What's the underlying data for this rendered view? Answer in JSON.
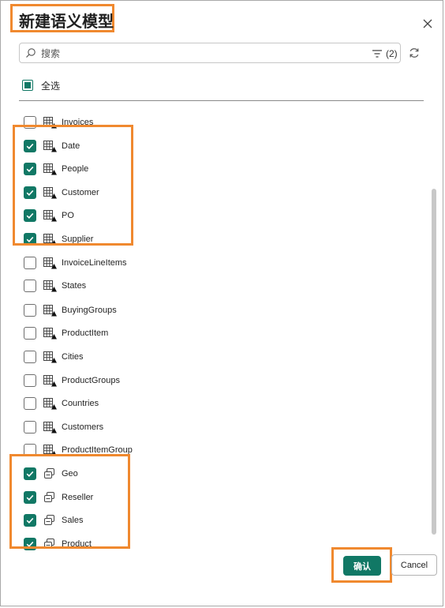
{
  "dialog": {
    "title": "新建语义模型",
    "close_icon": "close-icon"
  },
  "search": {
    "placeholder": "搜索",
    "filter_count": "(2)",
    "search_icon": "search-icon",
    "filter_icon": "filter-icon",
    "refresh_icon": "refresh-icon"
  },
  "select_all": {
    "label": "全选",
    "state": "indeterminate"
  },
  "items": [
    {
      "label": "Invoices",
      "checked": false,
      "icon": "table-icon"
    },
    {
      "label": "Date",
      "checked": true,
      "icon": "table-icon"
    },
    {
      "label": "People",
      "checked": true,
      "icon": "table-icon"
    },
    {
      "label": "Customer",
      "checked": true,
      "icon": "table-icon"
    },
    {
      "label": "PO",
      "checked": true,
      "icon": "table-icon"
    },
    {
      "label": "Supplier",
      "checked": true,
      "icon": "table-icon"
    },
    {
      "label": "InvoiceLineItems",
      "checked": false,
      "icon": "table-icon"
    },
    {
      "label": "States",
      "checked": false,
      "icon": "table-icon"
    },
    {
      "label": "BuyingGroups",
      "checked": false,
      "icon": "table-icon"
    },
    {
      "label": "ProductItem",
      "checked": false,
      "icon": "table-icon"
    },
    {
      "label": "Cities",
      "checked": false,
      "icon": "table-icon"
    },
    {
      "label": "ProductGroups",
      "checked": false,
      "icon": "table-icon"
    },
    {
      "label": "Countries",
      "checked": false,
      "icon": "table-icon"
    },
    {
      "label": "Customers",
      "checked": false,
      "icon": "table-icon"
    },
    {
      "label": "ProductItemGroup",
      "checked": false,
      "icon": "table-icon"
    },
    {
      "label": "Geo",
      "checked": true,
      "icon": "view-icon"
    },
    {
      "label": "Reseller",
      "checked": true,
      "icon": "view-icon"
    },
    {
      "label": "Sales",
      "checked": true,
      "icon": "view-icon"
    },
    {
      "label": "Product",
      "checked": true,
      "icon": "view-icon"
    }
  ],
  "footer": {
    "confirm_label": "确认",
    "cancel_label": "Cancel"
  },
  "colors": {
    "accent": "#117865",
    "highlight": "#f0892f"
  }
}
